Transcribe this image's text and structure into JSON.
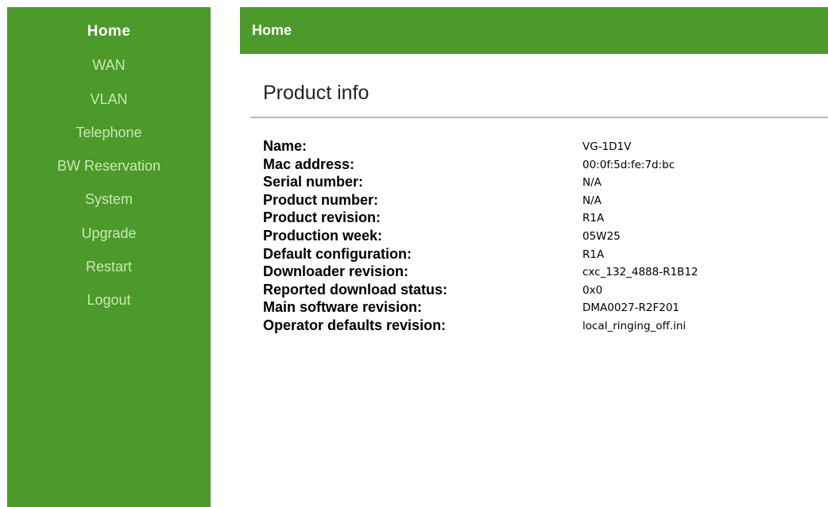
{
  "sidebar": {
    "items": [
      {
        "label": "Home",
        "active": true
      },
      {
        "label": "WAN",
        "active": false
      },
      {
        "label": "VLAN",
        "active": false
      },
      {
        "label": "Telephone",
        "active": false
      },
      {
        "label": "BW Reservation",
        "active": false
      },
      {
        "label": "System",
        "active": false
      },
      {
        "label": "Upgrade",
        "active": false
      },
      {
        "label": "Restart",
        "active": false
      },
      {
        "label": "Logout",
        "active": false
      }
    ]
  },
  "header": {
    "title": "Home"
  },
  "main": {
    "section_title": "Product info",
    "info": [
      {
        "label": "Name:",
        "value": "VG-1D1V"
      },
      {
        "label": "Mac address:",
        "value": "00:0f:5d:fe:7d:bc"
      },
      {
        "label": "Serial number:",
        "value": "N/A"
      },
      {
        "label": "Product number:",
        "value": "N/A"
      },
      {
        "label": "Product revision:",
        "value": "R1A"
      },
      {
        "label": "Production week:",
        "value": "05W25"
      },
      {
        "label": "Default configuration:",
        "value": "R1A"
      },
      {
        "label": "Downloader revision:",
        "value": "cxc_132_4888-R1B12"
      },
      {
        "label": "Reported download status:",
        "value": "0x0"
      },
      {
        "label": "Main software revision:",
        "value": "DMA0027-R2F201"
      },
      {
        "label": "Operator defaults revision:",
        "value": "local_ringing_off.ini"
      }
    ]
  },
  "colors": {
    "brand_green": "#4c9a2a",
    "nav_inactive": "#c9e8b6",
    "divider": "#b8b8b8"
  }
}
